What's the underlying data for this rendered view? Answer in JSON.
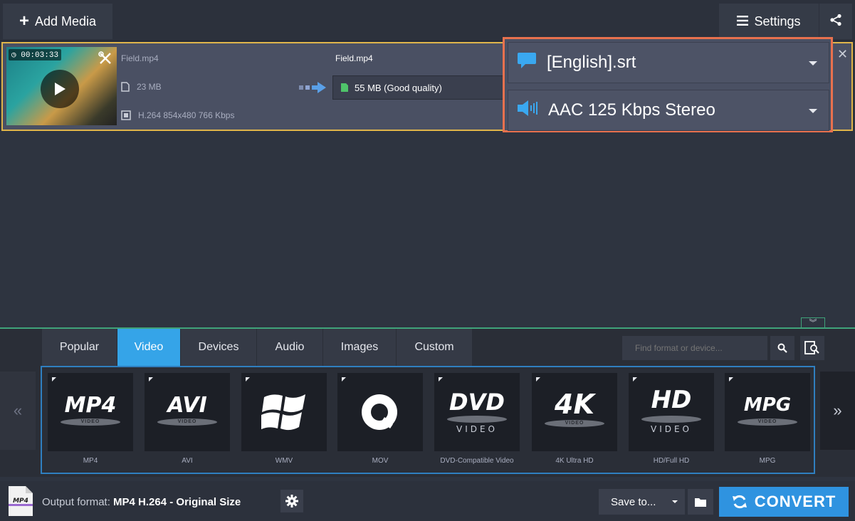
{
  "toolbar": {
    "add_media_label": "Add Media",
    "settings_label": "Settings"
  },
  "file": {
    "duration": "00:03:33",
    "source_name": "Field.mp4",
    "source_size": "23 MB",
    "source_codec": "H.264 854x480 766 Kbps",
    "output_name": "Field.mp4",
    "output_size": "55 MB (Good quality)",
    "subtitle_value": "[English].srt",
    "audio_value": "AAC 125 Kbps Stereo"
  },
  "tabs": [
    {
      "label": "Popular",
      "active": false
    },
    {
      "label": "Video",
      "active": true
    },
    {
      "label": "Devices",
      "active": false
    },
    {
      "label": "Audio",
      "active": false
    },
    {
      "label": "Images",
      "active": false
    },
    {
      "label": "Custom",
      "active": false
    }
  ],
  "search": {
    "placeholder": "Find format or device..."
  },
  "nav": {
    "prev": "«",
    "next": "»"
  },
  "formats": [
    {
      "logo": "MP4",
      "disc": "VIDEO",
      "label": "MP4"
    },
    {
      "logo": "AVI",
      "disc": "VIDEO",
      "label": "AVI"
    },
    {
      "logo": "",
      "disc": "",
      "label": "WMV"
    },
    {
      "logo": "",
      "disc": "",
      "label": "MOV"
    },
    {
      "logo": "DVD",
      "disc": "VIDEO",
      "label": "DVD-Compatible Video"
    },
    {
      "logo": "4K",
      "disc": "VIDEO",
      "label": "4K Ultra HD"
    },
    {
      "logo": "HD",
      "disc": "VIDEO",
      "label": "HD/Full HD"
    },
    {
      "logo": "MPG",
      "disc": "VIDEO",
      "label": "MPG"
    }
  ],
  "bottom": {
    "file_icon_text": "MP4",
    "output_prefix": "Output format:",
    "output_value": "MP4 H.264 - Original Size",
    "save_to_label": "Save to...",
    "convert_label": "CONVERT"
  },
  "colors": {
    "accent": "#35a4e8",
    "highlight_border": "#e8714e",
    "selected_row_border": "#e0b54a"
  }
}
